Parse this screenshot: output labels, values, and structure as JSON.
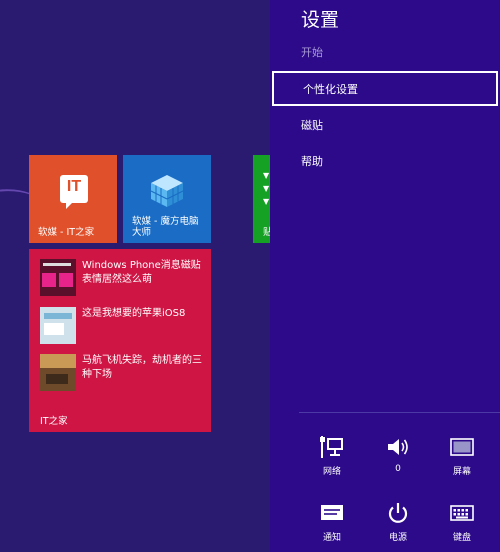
{
  "start_screen": {
    "tiles": {
      "ithome": {
        "label": "软媒 - IT之家",
        "logo_text": "IT"
      },
      "cube": {
        "label": "软媒 - 魔方电脑大师"
      },
      "partial": {
        "label": "贴"
      },
      "live": {
        "label": "IT之家",
        "items": [
          {
            "text": "Windows Phone消息磁贴表情居然这么萌"
          },
          {
            "text": "这是我想要的苹果iOS8"
          },
          {
            "text": "马航飞机失踪，劫机者的三种下场"
          }
        ]
      }
    }
  },
  "charm": {
    "title": "设置",
    "subtitle": "开始",
    "items": [
      {
        "label": "个性化设置"
      },
      {
        "label": "磁贴"
      },
      {
        "label": "帮助"
      }
    ],
    "quick_settings": {
      "network": {
        "label": "网络",
        "icon": "network-icon"
      },
      "volume": {
        "label": "0",
        "icon": "speaker-icon"
      },
      "screen": {
        "label": "屏幕",
        "icon": "screen-icon"
      },
      "notifications": {
        "label": "通知",
        "icon": "notification-icon"
      },
      "power": {
        "label": "电源",
        "icon": "power-icon"
      },
      "keyboard": {
        "label": "键盘",
        "icon": "keyboard-icon"
      }
    }
  },
  "colors": {
    "start_background": "#2a1a70",
    "charm_background": "#2c0a8a",
    "tile_orange": "#e0502b",
    "tile_blue": "#1a6cc4",
    "tile_green": "#14a124",
    "tile_crimson": "#cf1544"
  }
}
